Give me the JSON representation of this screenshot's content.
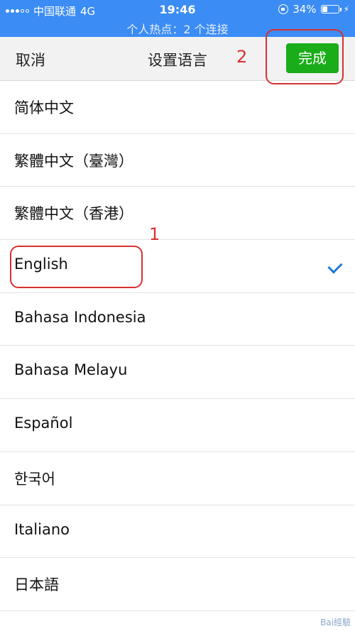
{
  "status_bar": {
    "carrier": "中国联通",
    "network": "4G",
    "time": "19:46",
    "battery": "34%",
    "battery_level": 0.34,
    "hotspot": "个人热点：2 个连接"
  },
  "nav": {
    "cancel": "取消",
    "title": "设置语言",
    "done": "完成"
  },
  "languages": [
    {
      "label": "简体中文",
      "selected": false
    },
    {
      "label": "繁體中文（臺灣）",
      "selected": false
    },
    {
      "label": "繁體中文（香港）",
      "selected": false
    },
    {
      "label": "English",
      "selected": true
    },
    {
      "label": "Bahasa Indonesia",
      "selected": false
    },
    {
      "label": "Bahasa Melayu",
      "selected": false
    },
    {
      "label": "Español",
      "selected": false
    },
    {
      "label": "한국어",
      "selected": false
    },
    {
      "label": "Italiano",
      "selected": false
    },
    {
      "label": "日本語",
      "selected": false
    }
  ],
  "annotations": {
    "first": "1",
    "second": "2"
  },
  "watermark": "Bai經驗",
  "colors": {
    "status_bar": "#3b8cf5",
    "done_button": "#1aad19",
    "check": "#1f7ad9",
    "annotation": "#d93030"
  }
}
